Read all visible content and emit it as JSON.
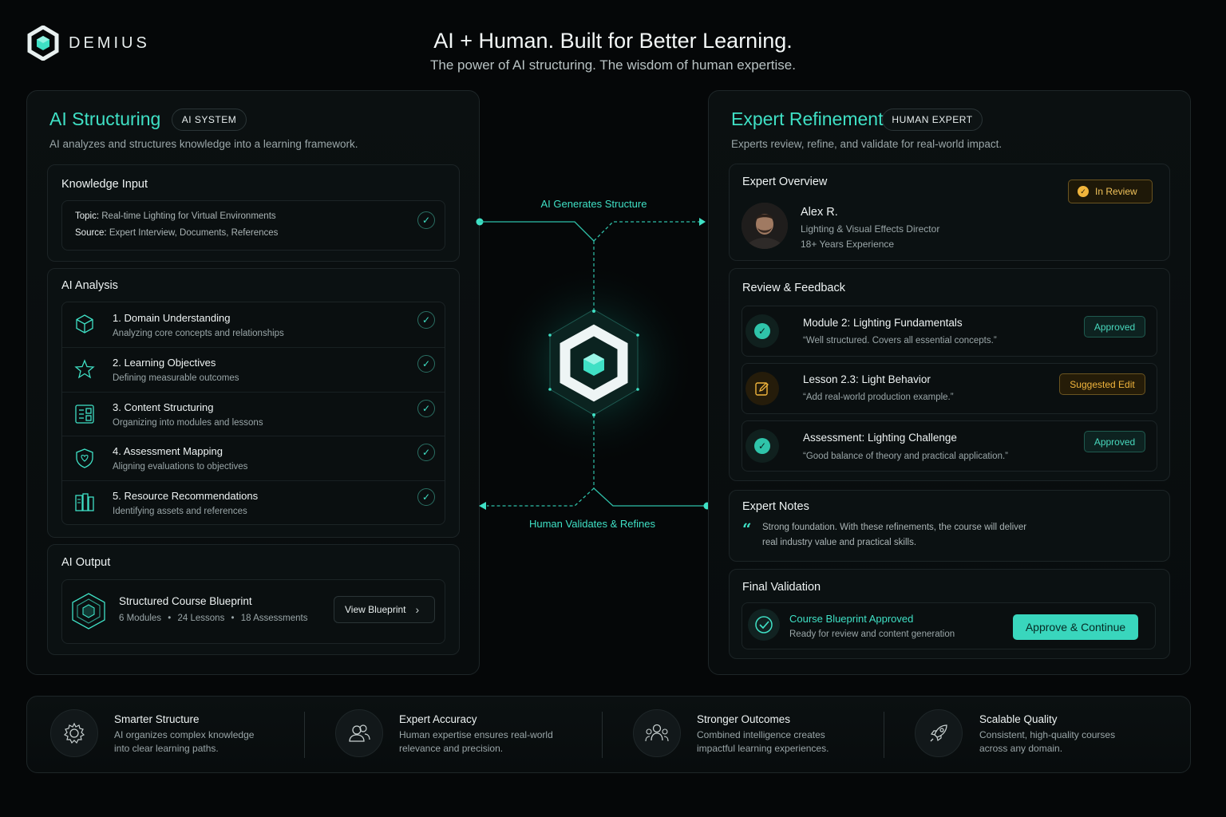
{
  "brand": {
    "name": "DEMIUS"
  },
  "hero": {
    "title": "AI + Human. Built for Better Learning.",
    "subtitle": "The power of AI structuring. The wisdom of human expertise."
  },
  "ai_panel": {
    "title": "AI Structuring",
    "tag": "AI SYSTEM",
    "description": "AI analyzes and structures knowledge into a learning framework.",
    "knowledge_input": {
      "heading": "Knowledge Input",
      "topic_label": "Topic:",
      "topic_value": "Real-time Lighting for Virtual Environments",
      "source_label": "Source:",
      "source_value": "Expert Interview, Documents, References"
    },
    "analysis": {
      "heading": "AI Analysis",
      "steps": [
        {
          "title": "1. Domain Understanding",
          "desc": "Analyzing core concepts and relationships",
          "icon": "cube-icon"
        },
        {
          "title": "2. Learning Objectives",
          "desc": "Defining measurable outcomes",
          "icon": "star-icon"
        },
        {
          "title": "3. Content Structuring",
          "desc": "Organizing into modules and lessons",
          "icon": "layout-icon"
        },
        {
          "title": "4. Assessment Mapping",
          "desc": "Aligning evaluations to objectives",
          "icon": "shield-icon"
        },
        {
          "title": "5. Resource Recommendations",
          "desc": "Identifying assets and references",
          "icon": "resources-icon"
        }
      ]
    },
    "output": {
      "heading": "AI Output",
      "item_title": "Structured Course Blueprint",
      "modules": "6 Modules",
      "lessons": "24 Lessons",
      "assessments": "18 Assessments",
      "button": "View Blueprint"
    }
  },
  "flow": {
    "top_label": "AI Generates Structure",
    "bottom_label": "Human Validates & Refines"
  },
  "expert_panel": {
    "title": "Expert Refinement",
    "tag": "HUMAN EXPERT",
    "description": "Experts review, refine, and validate for real-world impact.",
    "overview": {
      "heading": "Expert Overview",
      "status": "In Review",
      "name": "Alex R.",
      "role": "Lighting & Visual Effects Director",
      "experience": "18+ Years Experience"
    },
    "review": {
      "heading": "Review & Feedback",
      "items": [
        {
          "title": "Module 2: Lighting Fundamentals",
          "quote": "“Well structured. Covers all essential concepts.”",
          "status": "Approved"
        },
        {
          "title": "Lesson 2.3: Light Behavior",
          "quote": "“Add real-world production example.”",
          "status": "Suggested Edit"
        },
        {
          "title": "Assessment: Lighting Challenge",
          "quote": "“Good balance of theory and practical application.”",
          "status": "Approved"
        }
      ]
    },
    "notes": {
      "heading": "Expert Notes",
      "line1": "Strong foundation. With these refinements, the course will deliver",
      "line2": "real industry value and practical skills."
    },
    "final": {
      "heading": "Final Validation",
      "status_title": "Course Blueprint Approved",
      "status_desc": "Ready for review and content generation",
      "button": "Approve & Continue"
    }
  },
  "features": [
    {
      "title": "Smarter Structure",
      "line1": "AI organizes complex knowledge",
      "line2": "into clear learning paths.",
      "icon": "gear-icon"
    },
    {
      "title": "Expert Accuracy",
      "line1": "Human expertise ensures real-world",
      "line2": "relevance and precision.",
      "icon": "users-icon"
    },
    {
      "title": "Stronger Outcomes",
      "line1": "Combined intelligence creates",
      "line2": "impactful learning experiences.",
      "icon": "team-icon"
    },
    {
      "title": "Scalable Quality",
      "line1": "Consistent, high-quality courses",
      "line2": "across any domain.",
      "icon": "rocket-icon"
    }
  ],
  "colors": {
    "accent": "#3fe0c5",
    "warning": "#f1b53c",
    "background": "#050708"
  }
}
